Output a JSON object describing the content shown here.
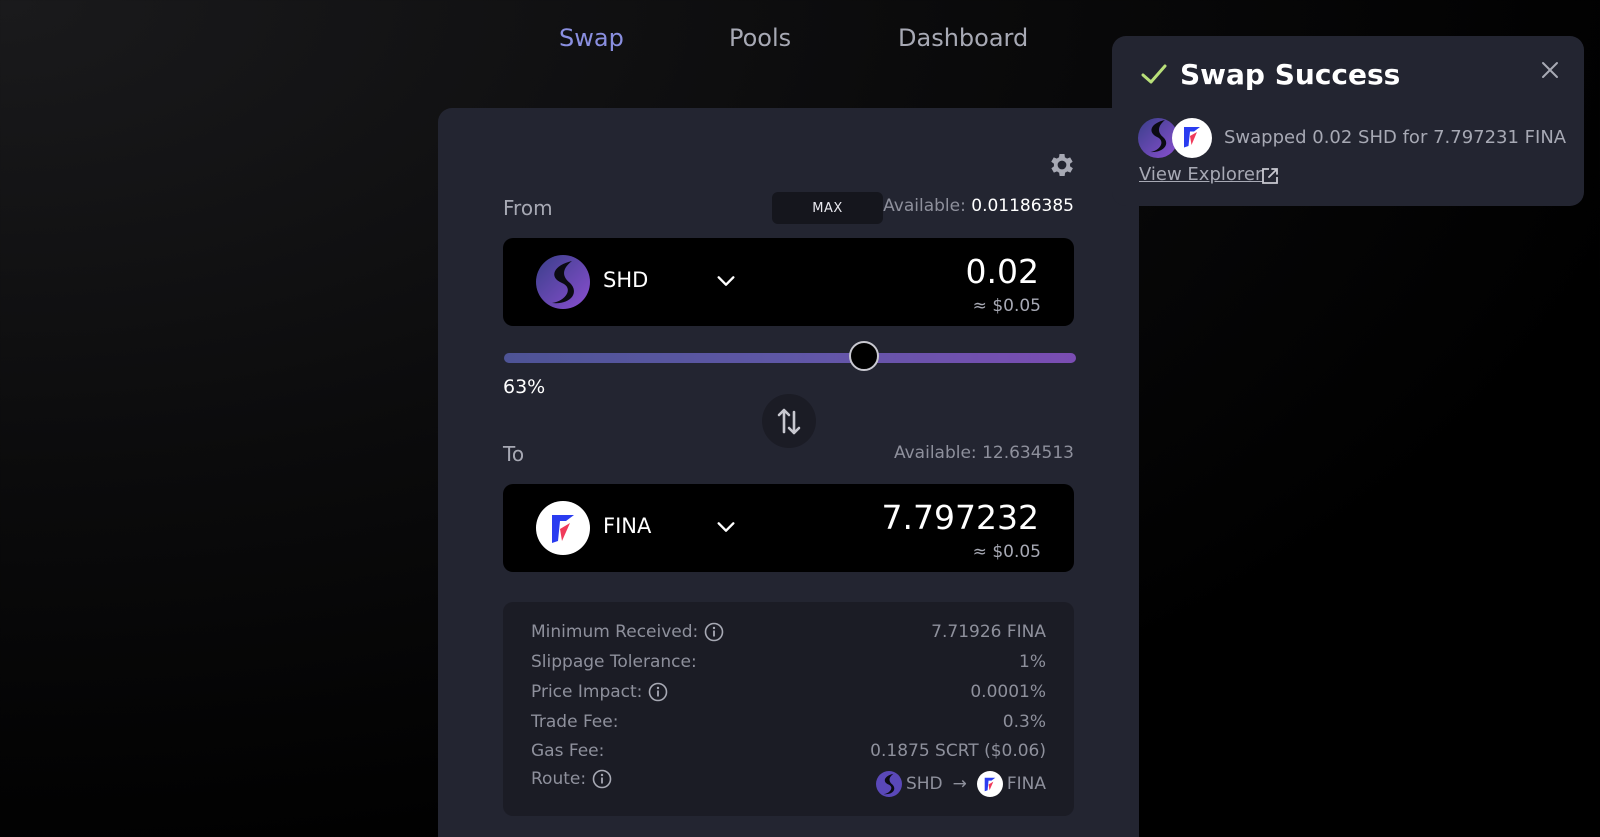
{
  "nav": {
    "tabs": [
      {
        "label": "Swap",
        "active": true
      },
      {
        "label": "Pools",
        "active": false
      },
      {
        "label": "Dashboard",
        "active": false
      }
    ]
  },
  "from": {
    "label": "From",
    "max_label": "MAX",
    "available_label": "Available:",
    "available_value": "0.01186385",
    "token": "SHD",
    "amount": "0.02",
    "usd": "≈ $0.05"
  },
  "slider": {
    "percent": 63,
    "label": "63%"
  },
  "to": {
    "label": "To",
    "available_text": "Available: 12.634513",
    "token": "FINA",
    "amount": "7.797232",
    "usd": "≈ $0.05"
  },
  "details": {
    "rows": [
      {
        "label": "Minimum Received:",
        "value": "7.71926 FINA",
        "info": true
      },
      {
        "label": "Slippage Tolerance:",
        "value": "1%",
        "info": false
      },
      {
        "label": "Price Impact:",
        "value": "0.0001%",
        "info": true
      },
      {
        "label": "Trade Fee:",
        "value": "0.3%",
        "info": false
      },
      {
        "label": "Gas Fee:",
        "value": "0.1875 SCRT ($0.06)",
        "info": false
      }
    ],
    "route": {
      "label": "Route:",
      "from": "SHD",
      "arrow": "→",
      "to": "FINA"
    }
  },
  "toast": {
    "title": "Swap Success",
    "message": "Swapped 0.02 SHD for 7.797231 FINA",
    "link": "View Explorer"
  },
  "colors": {
    "accent": "#8a8fe0",
    "success": "#b9e07a",
    "card": "#232531",
    "panel": "#1b1c25"
  },
  "icons": {
    "settings": "gear-icon",
    "dropdown": "chevron-down-icon",
    "swap_direction": "swap-arrows-icon",
    "info": "info-icon",
    "success": "check-icon",
    "close": "close-icon",
    "external": "external-link-icon"
  }
}
